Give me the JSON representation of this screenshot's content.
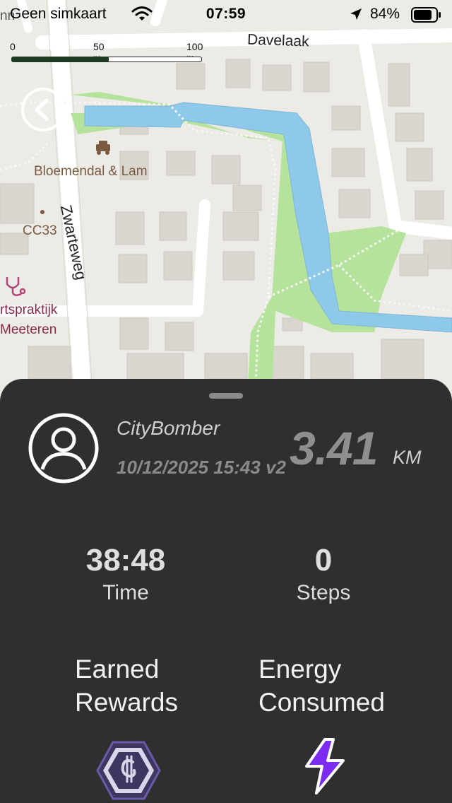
{
  "status_bar": {
    "carrier": "Geen simkaart",
    "time": "07:59",
    "battery_percent": "84%",
    "battery_level": 0.84
  },
  "map": {
    "labels": {
      "davelaak": "Davelaak",
      "zwarteweg": "Zwarteweg",
      "bloemendal": "Bloemendal & Lam",
      "cc33": "CC33",
      "praktijk_line1": "rtspraktijk",
      "praktijk_line2": "Meeteren",
      "top_left_fragment": "nn"
    },
    "scale": {
      "tick_0": "0",
      "tick_50": "50 m",
      "tick_100": "100 m"
    },
    "colors": {
      "water": "#8ec9ea",
      "park": "#b6e39b",
      "road": "#ffffff",
      "building": "#d9d6d0"
    }
  },
  "activity": {
    "user": "CityBomber",
    "datetime": "10/12/2025 15:43 v2",
    "distance": "3.41",
    "distance_unit": "KM",
    "time_value": "38:48",
    "time_label": "Time",
    "steps_value": "0",
    "steps_label": "Steps",
    "rewards_line1": "Earned",
    "rewards_line2": "Rewards",
    "energy_line1": "Energy",
    "energy_line2": "Consumed"
  },
  "colors": {
    "sheet_bg": "#2f2f2f",
    "accent_purple": "#7b2cf0",
    "hex_purple": "#5a4a8a"
  }
}
